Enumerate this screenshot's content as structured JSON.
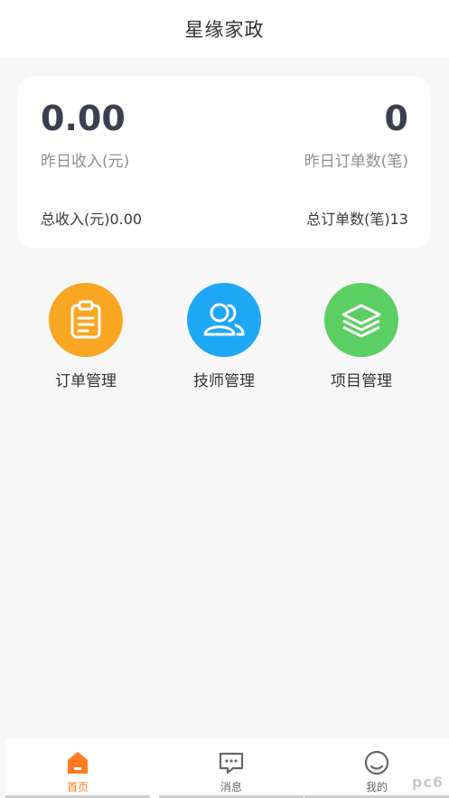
{
  "header": {
    "title": "星缘家政"
  },
  "summary": {
    "yesterday_income": "0.00",
    "yesterday_income_label": "昨日收入(元)",
    "yesterday_orders": "0",
    "yesterday_orders_label": "昨日订单数(笔)",
    "total_income": "总收入(元)0.00",
    "total_orders": "总订单数(笔)13"
  },
  "menu": {
    "items": [
      {
        "label": "订单管理",
        "icon": "clipboard-icon",
        "color": "#f9a623"
      },
      {
        "label": "技师管理",
        "icon": "users-icon",
        "color": "#1ea7f5"
      },
      {
        "label": "项目管理",
        "icon": "layers-icon",
        "color": "#5ccf63"
      }
    ]
  },
  "tabbar": {
    "items": [
      {
        "label": "首页",
        "icon": "home-icon",
        "active": true
      },
      {
        "label": "消息",
        "icon": "message-icon",
        "active": false
      },
      {
        "label": "我的",
        "icon": "profile-icon",
        "active": false
      }
    ],
    "active_color": "#ff7a22"
  },
  "watermark": {
    "text": "pc6"
  }
}
